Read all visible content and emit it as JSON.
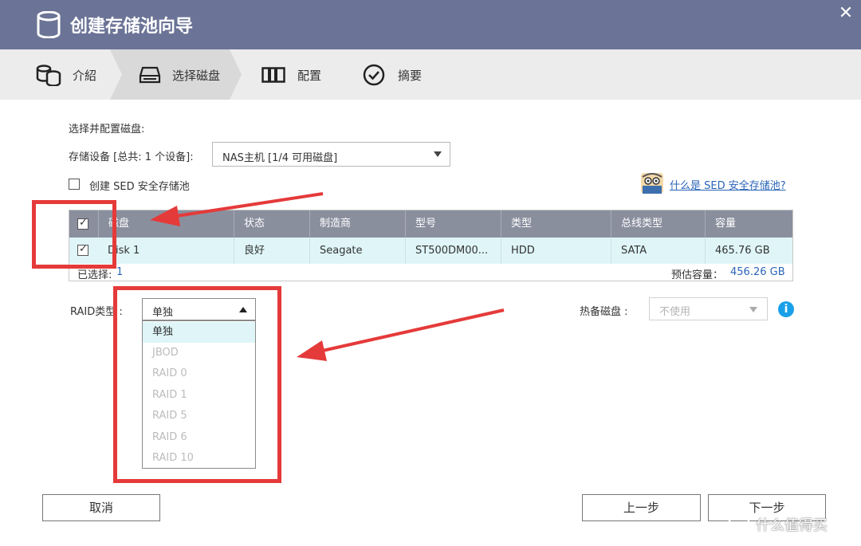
{
  "window": {
    "title": "创建存储池向导"
  },
  "steps": [
    {
      "label": "介紹",
      "icon": "database-icon"
    },
    {
      "label": "选择磁盘",
      "icon": "drive-icon"
    },
    {
      "label": "配置",
      "icon": "raid-config-icon"
    },
    {
      "label": "摘要",
      "icon": "check-circle-icon"
    }
  ],
  "content": {
    "section_title": "选择并配置磁盘:",
    "storage_device_label": "存储设备 [总共: 1 个设备]:",
    "storage_device_value": "NAS主机 [1/4 可用磁盘]",
    "sed_checkbox_label": "创建 SED 安全存储池",
    "sed_help_link": "什么是 SED 安全存储池?"
  },
  "table": {
    "headers": [
      "磁盘",
      "状态",
      "制造商",
      "型号",
      "类型",
      "总线类型",
      "容量"
    ],
    "rows": [
      {
        "checked": true,
        "cells": [
          "Disk 1",
          "良好",
          "Seagate",
          "ST500DM00...",
          "HDD",
          "SATA",
          "465.76 GB"
        ]
      }
    ],
    "selected_label": "已选择:",
    "selected_count": "1",
    "estimated_label": "预估容量：",
    "estimated_value": "456.26 GB"
  },
  "raid": {
    "label": "RAID类型 :",
    "selected": "单独",
    "options": [
      "单独",
      "JBOD",
      "RAID 0",
      "RAID 1",
      "RAID 5",
      "RAID 6",
      "RAID 10"
    ]
  },
  "spare": {
    "label": "热备磁盘 :",
    "value": "不使用"
  },
  "buttons": {
    "cancel": "取消",
    "prev": "上一步",
    "next": "下一步"
  },
  "watermark": "什么值得买",
  "colors": {
    "titlebar": "#6b7496",
    "annotation": "#e53a3a",
    "selected_row": "#dff5f8",
    "link": "#2a64b8"
  }
}
